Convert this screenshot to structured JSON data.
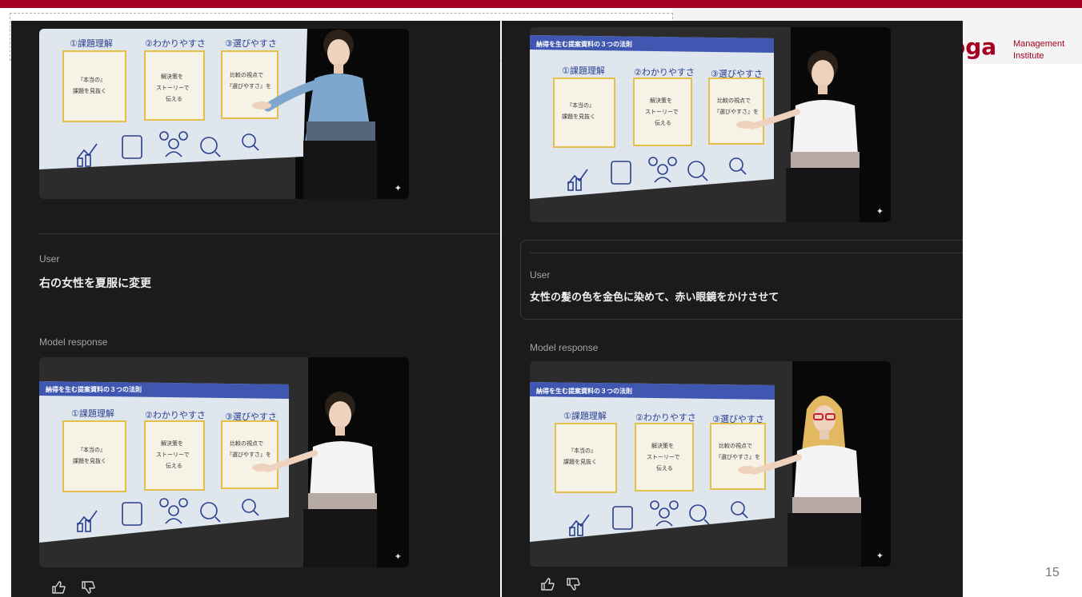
{
  "slide": {
    "logo_text": "oga",
    "logo_sub1": "Management",
    "logo_sub2": "Institute",
    "page_number": "15"
  },
  "left_panel": {
    "user_label": "User",
    "user_prompt": "右の女性を夏服に変更",
    "response_label": "Model response"
  },
  "right_panel": {
    "user_label": "User",
    "user_prompt": "女性の髪の色を金色に染めて、赤い眼鏡をかけさせて",
    "response_label": "Model response"
  },
  "projection": {
    "banner": "納得を生む提案資料の３つの法則",
    "headers": [
      "①課題理解",
      "②わかりやすさ",
      "③選びやすさ"
    ],
    "box1": [
      "『本当の』",
      "課題を見抜く"
    ],
    "box2": [
      "解決策を",
      "ストーリーで",
      "伝える"
    ],
    "box3": [
      "比較の視点で",
      "『選びやすさ』を"
    ]
  },
  "colors": {
    "accent": "#a50021",
    "panel_bg": "#1b1b1b"
  },
  "icons": {
    "sparkle": "✦",
    "thumbs_up": "thumbs-up-icon",
    "thumbs_down": "thumbs-down-icon"
  }
}
